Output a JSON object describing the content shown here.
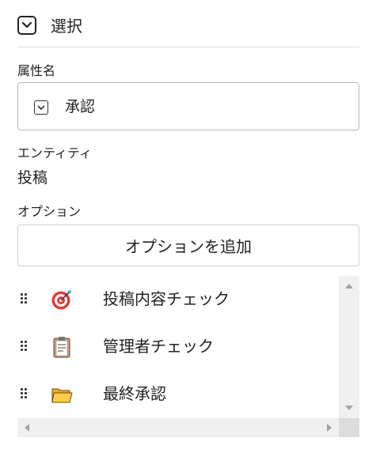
{
  "header": {
    "title": "選択",
    "type_icon": "chevron-down-square-icon"
  },
  "attribute": {
    "label": "属性名",
    "value": "承認",
    "type_icon": "chevron-down-square-icon"
  },
  "entity": {
    "label": "エンティティ",
    "value": "投稿"
  },
  "options": {
    "label": "オプション",
    "add_button": "オプションを追加",
    "items": [
      {
        "text": "投稿内容チェック",
        "icon": "target-dart-icon"
      },
      {
        "text": "管理者チェック",
        "icon": "clipboard-icon"
      },
      {
        "text": "最終承認",
        "icon": "folder-icon"
      }
    ]
  }
}
